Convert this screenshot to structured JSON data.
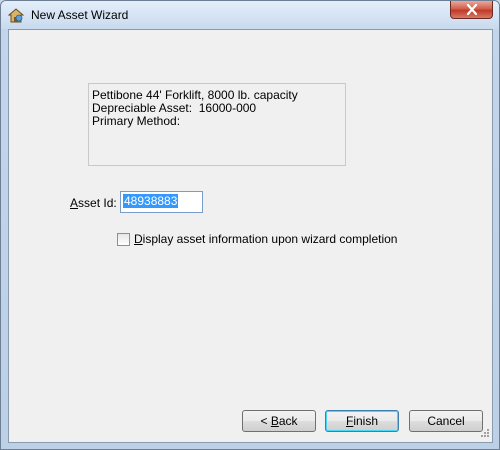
{
  "window": {
    "title": "New Asset Wizard"
  },
  "info": {
    "lines": [
      "Pettibone 44' Forklift, 8000 lb. capacity",
      "Depreciable Asset:  16000-000",
      "Primary Method:"
    ]
  },
  "asset_id": {
    "label_underlined": "A",
    "label_rest": "sset Id:",
    "value": "48938883"
  },
  "display_option": {
    "label_underlined": "D",
    "label_rest": "isplay asset information upon wizard completion",
    "checked": false
  },
  "buttons": {
    "back_prefix": "< ",
    "back_underlined": "B",
    "back_rest": "ack",
    "finish_underlined": "F",
    "finish_rest": "inish",
    "cancel": "Cancel"
  },
  "colors": {
    "selection": "#3399ff",
    "dialog_bg": "#f0f0f0"
  },
  "icons": [
    "app-icon",
    "close-icon",
    "resize-grip-icon"
  ]
}
